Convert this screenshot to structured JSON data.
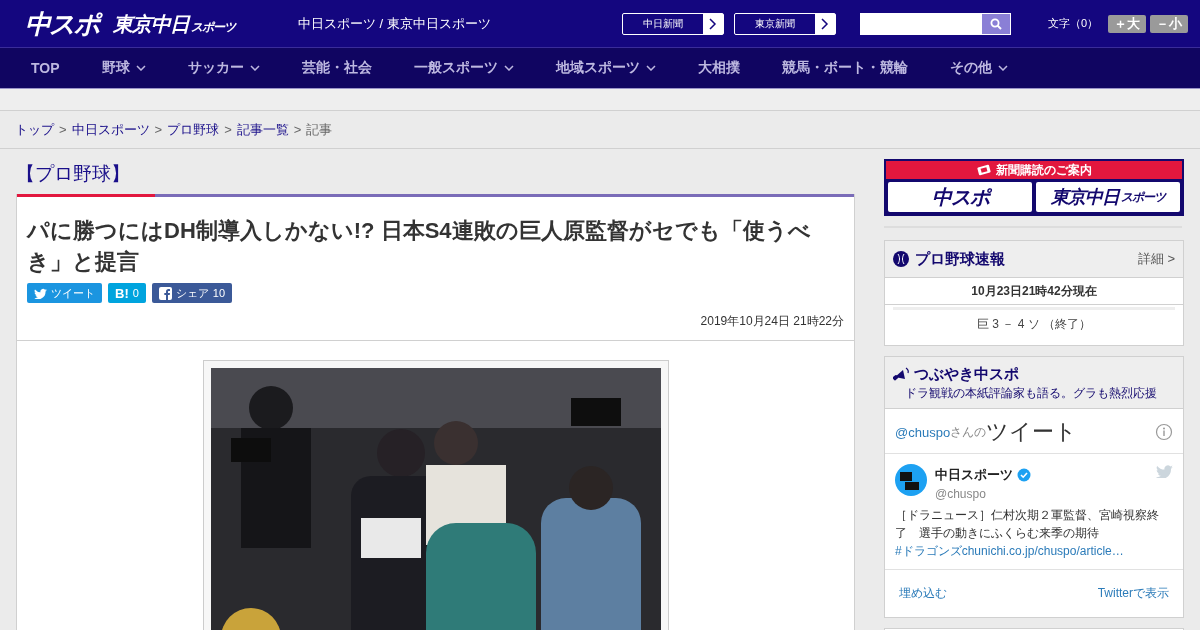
{
  "header": {
    "logo": "中スポ",
    "logo_sub": {
      "main": "東京中日",
      "small": "スポーツ"
    },
    "tagline": "中日スポーツ / 東京中日スポーツ",
    "paper_links": [
      "中日新聞",
      "東京新聞"
    ],
    "font_size": {
      "label": "文字（0）",
      "buttons": [
        "＋大",
        "－小"
      ]
    }
  },
  "nav": [
    {
      "label": "TOP",
      "dropdown": false
    },
    {
      "label": "野球",
      "dropdown": true
    },
    {
      "label": "サッカー",
      "dropdown": true
    },
    {
      "label": "芸能・社会",
      "dropdown": false
    },
    {
      "label": "一般スポーツ",
      "dropdown": true
    },
    {
      "label": "地域スポーツ",
      "dropdown": true
    },
    {
      "label": "大相撲",
      "dropdown": false
    },
    {
      "label": "競馬・ボート・競輪",
      "dropdown": false
    },
    {
      "label": "その他",
      "dropdown": true
    }
  ],
  "breadcrumb": {
    "separator": ">",
    "items": [
      {
        "label": "トップ",
        "link": true
      },
      {
        "label": "中日スポーツ",
        "link": true
      },
      {
        "label": "プロ野球",
        "link": true
      },
      {
        "label": "記事一覧",
        "link": true
      },
      {
        "label": "記事",
        "link": false
      }
    ]
  },
  "article": {
    "category": "【プロ野球】",
    "title": "パに勝つにはDH制導入しかない!? 日本S4連敗の巨人原監督がセでも「使うべき」と提言",
    "share": [
      {
        "kind": "tweet",
        "label": "ツイート"
      },
      {
        "kind": "hatena",
        "label": "B!",
        "count": "0"
      },
      {
        "kind": "facebook",
        "label": "シェア",
        "count": "10"
      }
    ],
    "date": "2019年10月24日 21時22分"
  },
  "sidebar": {
    "subscribe": {
      "title": "新聞購読のご案内",
      "logos": [
        {
          "kind": "chuspo",
          "main": "中スポ"
        },
        {
          "kind": "tokyo",
          "main": "東京中日",
          "small": "スポーツ"
        }
      ]
    },
    "scores": {
      "title": "プロ野球速報",
      "detail": "詳細 >",
      "timestamp": "10月23日21時42分現在",
      "games": [
        "巨 3 － 4 ソ （終了）"
      ]
    },
    "tweets": {
      "title": "つぶやき中スポ",
      "subtitle": "ドラ観戦の本紙評論家も語る。グラも熱烈応援",
      "user": "@chuspo",
      "suffix": "さんの",
      "heading": "ツイート",
      "tweet": {
        "name": "中日スポーツ",
        "verified": true,
        "handle": "@chuspo",
        "text": "［ドラニュース］仁村次期２軍監督、宮崎視察終了　選手の動きにふくらむ来季の期待",
        "hashtag": "#ドラゴンズ",
        "link": "chunichi.co.jp/chuspo/article…"
      },
      "actions": [
        "埋め込む",
        "Twitterで表示"
      ]
    }
  }
}
